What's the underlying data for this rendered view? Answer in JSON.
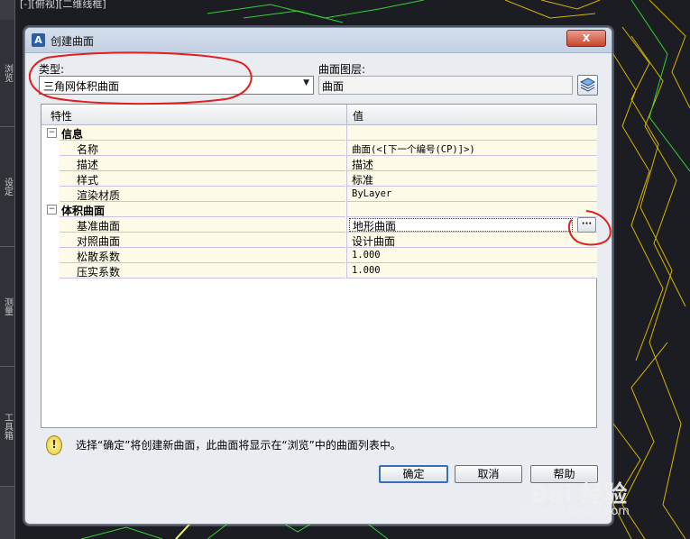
{
  "background": {
    "top_caption": "[-][俯视][二维线框]",
    "side_tabs": [
      "浏览",
      "设定",
      "测量",
      "工具箱"
    ]
  },
  "dialog": {
    "title": "创建曲面",
    "close_label": "X",
    "type_label": "类型:",
    "type_value": "三角网体积曲面",
    "layer_label": "曲面图层:",
    "layer_value": "曲面",
    "grid": {
      "col_property": "特性",
      "col_value": "值",
      "sections": [
        {
          "name": "信息",
          "rows": [
            {
              "prop": "名称",
              "value": "曲面(<[下一个编号(CP)]>)"
            },
            {
              "prop": "描述",
              "value": "描述"
            },
            {
              "prop": "样式",
              "value": "标准"
            },
            {
              "prop": "渲染材质",
              "value": "ByLayer"
            }
          ]
        },
        {
          "name": "体积曲面",
          "rows": [
            {
              "prop": "基准曲面",
              "value": "地形曲面"
            },
            {
              "prop": "对照曲面",
              "value": "设计曲面"
            },
            {
              "prop": "松散系数",
              "value": "1.000"
            },
            {
              "prop": "压实系数",
              "value": "1.000"
            }
          ]
        }
      ]
    },
    "hint": "选择“确定”将创建新曲面，此曲面将显示在“浏览”中的曲面列表中。",
    "buttons": {
      "ok": "确定",
      "cancel": "取消",
      "help": "帮助"
    }
  },
  "watermark": {
    "logo": "Bai 经验",
    "site": "jingyan.baidu.com"
  },
  "colors": {
    "annotation": "#e02020",
    "cad_yellow": "#d8c200",
    "cad_green": "#35d135"
  }
}
